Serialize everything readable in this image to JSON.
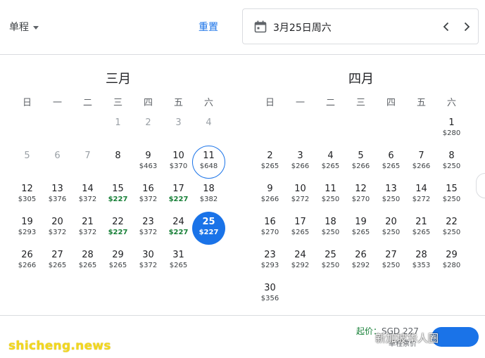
{
  "topbar": {
    "trip_type": "单程",
    "reset_label": "重置",
    "selected_date": "3月25日周六"
  },
  "weekdays": [
    "日",
    "一",
    "二",
    "三",
    "四",
    "五",
    "六"
  ],
  "months": [
    {
      "title": "三月",
      "first_weekday": 3,
      "days": [
        {
          "d": "1",
          "p": "",
          "state": "past"
        },
        {
          "d": "2",
          "p": "",
          "state": "past"
        },
        {
          "d": "3",
          "p": "",
          "state": "past"
        },
        {
          "d": "4",
          "p": "",
          "state": "past"
        },
        {
          "d": "5",
          "p": "",
          "state": "past"
        },
        {
          "d": "6",
          "p": "",
          "state": "past"
        },
        {
          "d": "7",
          "p": "",
          "state": "past"
        },
        {
          "d": "8",
          "p": "",
          "state": ""
        },
        {
          "d": "9",
          "p": "$463",
          "state": ""
        },
        {
          "d": "10",
          "p": "$370",
          "state": ""
        },
        {
          "d": "11",
          "p": "$648",
          "state": "return"
        },
        {
          "d": "12",
          "p": "$305",
          "state": ""
        },
        {
          "d": "13",
          "p": "$376",
          "state": ""
        },
        {
          "d": "14",
          "p": "$372",
          "state": ""
        },
        {
          "d": "15",
          "p": "$227",
          "state": "low"
        },
        {
          "d": "16",
          "p": "$372",
          "state": ""
        },
        {
          "d": "17",
          "p": "$227",
          "state": "low"
        },
        {
          "d": "18",
          "p": "$382",
          "state": ""
        },
        {
          "d": "19",
          "p": "$293",
          "state": ""
        },
        {
          "d": "20",
          "p": "$372",
          "state": ""
        },
        {
          "d": "21",
          "p": "$372",
          "state": ""
        },
        {
          "d": "22",
          "p": "$227",
          "state": "low"
        },
        {
          "d": "23",
          "p": "$372",
          "state": ""
        },
        {
          "d": "24",
          "p": "$227",
          "state": "low"
        },
        {
          "d": "25",
          "p": "$227",
          "state": "depart"
        },
        {
          "d": "26",
          "p": "$266",
          "state": ""
        },
        {
          "d": "27",
          "p": "$265",
          "state": ""
        },
        {
          "d": "28",
          "p": "$265",
          "state": ""
        },
        {
          "d": "29",
          "p": "$265",
          "state": ""
        },
        {
          "d": "30",
          "p": "$372",
          "state": ""
        },
        {
          "d": "31",
          "p": "$265",
          "state": ""
        }
      ]
    },
    {
      "title": "四月",
      "first_weekday": 6,
      "days": [
        {
          "d": "1",
          "p": "$280",
          "state": ""
        },
        {
          "d": "2",
          "p": "$265",
          "state": ""
        },
        {
          "d": "3",
          "p": "$266",
          "state": ""
        },
        {
          "d": "4",
          "p": "$265",
          "state": ""
        },
        {
          "d": "5",
          "p": "$266",
          "state": ""
        },
        {
          "d": "6",
          "p": "$265",
          "state": ""
        },
        {
          "d": "7",
          "p": "$266",
          "state": ""
        },
        {
          "d": "8",
          "p": "$250",
          "state": ""
        },
        {
          "d": "9",
          "p": "$266",
          "state": ""
        },
        {
          "d": "10",
          "p": "$272",
          "state": ""
        },
        {
          "d": "11",
          "p": "$250",
          "state": ""
        },
        {
          "d": "12",
          "p": "$270",
          "state": ""
        },
        {
          "d": "13",
          "p": "$250",
          "state": ""
        },
        {
          "d": "14",
          "p": "$272",
          "state": ""
        },
        {
          "d": "15",
          "p": "$250",
          "state": ""
        },
        {
          "d": "16",
          "p": "$270",
          "state": ""
        },
        {
          "d": "17",
          "p": "$265",
          "state": ""
        },
        {
          "d": "18",
          "p": "$250",
          "state": ""
        },
        {
          "d": "19",
          "p": "$265",
          "state": ""
        },
        {
          "d": "20",
          "p": "$250",
          "state": ""
        },
        {
          "d": "21",
          "p": "$265",
          "state": ""
        },
        {
          "d": "22",
          "p": "$250",
          "state": ""
        },
        {
          "d": "23",
          "p": "$293",
          "state": ""
        },
        {
          "d": "24",
          "p": "$292",
          "state": ""
        },
        {
          "d": "25",
          "p": "$250",
          "state": ""
        },
        {
          "d": "26",
          "p": "$292",
          "state": ""
        },
        {
          "d": "27",
          "p": "$250",
          "state": ""
        },
        {
          "d": "28",
          "p": "$353",
          "state": ""
        },
        {
          "d": "29",
          "p": "$280",
          "state": ""
        },
        {
          "d": "30",
          "p": "$356",
          "state": ""
        }
      ]
    }
  ],
  "footer": {
    "price_prefix": "起价：",
    "price_amount": "SGD 227",
    "price_sub": "单程票价"
  },
  "watermarks": {
    "site": "shicheng.news",
    "account": "新加坡华人圈"
  },
  "colors": {
    "accent": "#1a73e8",
    "low_price": "#188038",
    "watermark": "#f2d71f"
  }
}
